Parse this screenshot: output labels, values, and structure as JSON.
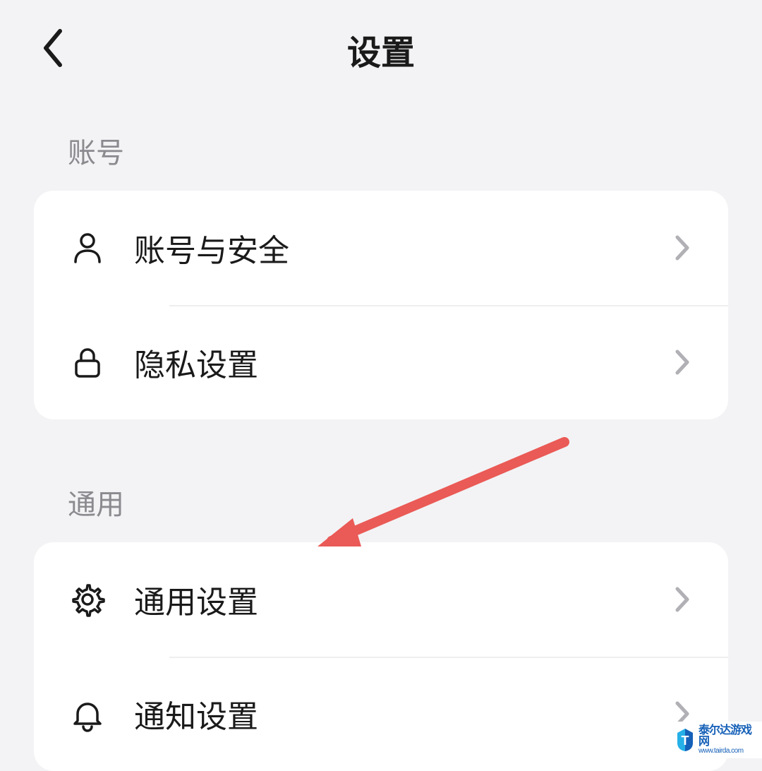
{
  "header": {
    "title": "设置"
  },
  "sections": {
    "account": {
      "label": "账号",
      "items": [
        {
          "label": "账号与安全",
          "icon": "person-icon"
        },
        {
          "label": "隐私设置",
          "icon": "lock-icon"
        }
      ]
    },
    "general": {
      "label": "通用",
      "items": [
        {
          "label": "通用设置",
          "icon": "gear-icon"
        },
        {
          "label": "通知设置",
          "icon": "bell-icon"
        }
      ]
    }
  },
  "annotation": {
    "arrow_color": "#ea5a56"
  },
  "watermark": {
    "line1": "泰尔达游戏网",
    "line2": "www.tairda.com"
  }
}
